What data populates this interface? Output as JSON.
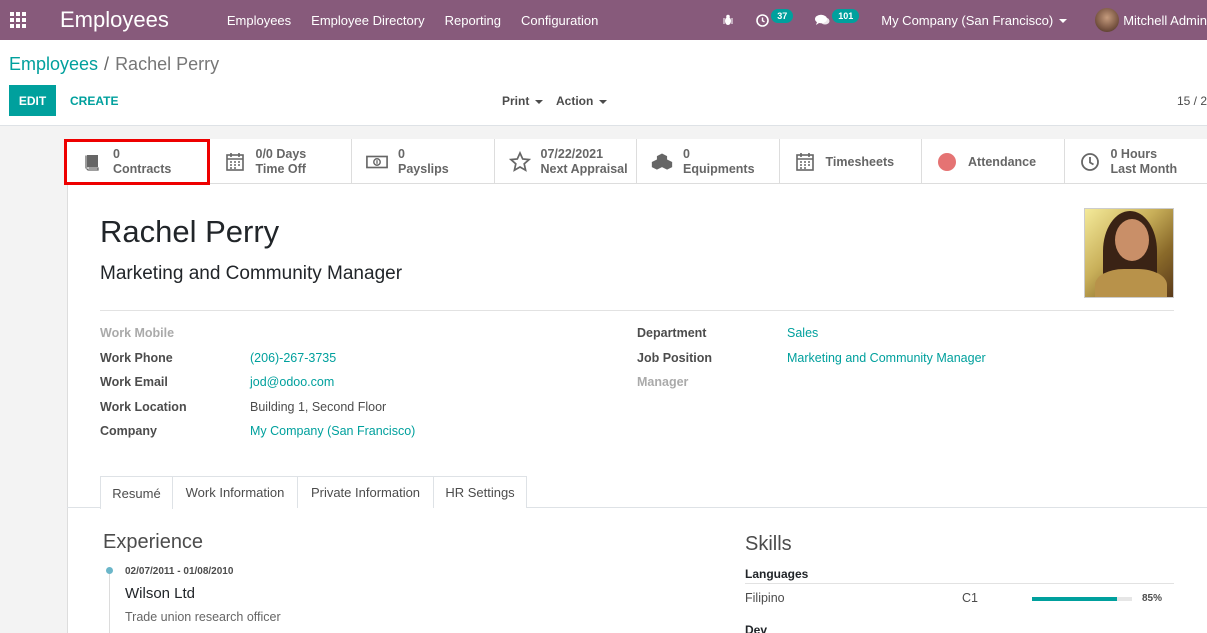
{
  "navbar": {
    "app_name": "Employees",
    "menu": [
      "Employees",
      "Employee Directory",
      "Reporting",
      "Configuration"
    ],
    "activity_count": "37",
    "message_count": "101",
    "company": "My Company (San Francisco)",
    "user": "Mitchell Admin",
    "bg_color": "#875a7b"
  },
  "control": {
    "breadcrumb_parent": "Employees",
    "breadcrumb_sep": "/",
    "breadcrumb_current": "Rachel Perry",
    "edit_label": "EDIT",
    "create_label": "CREATE",
    "print_label": "Print",
    "action_label": "Action",
    "pager": "15 / 2"
  },
  "smart_buttons": [
    {
      "value": "0",
      "label": "Contracts",
      "icon": "book-icon"
    },
    {
      "value": "0/0 Days",
      "label": "Time Off",
      "icon": "calendar-icon"
    },
    {
      "value": "0",
      "label": "Payslips",
      "icon": "money-icon"
    },
    {
      "value": "07/22/2021",
      "label": "Next Appraisal",
      "icon": "star-icon"
    },
    {
      "value": "0",
      "label": "Equipments",
      "icon": "cubes-icon"
    },
    {
      "value": "",
      "label": "Timesheets",
      "icon": "calendar-icon"
    },
    {
      "value": "",
      "label": "Attendance",
      "icon": "status-dot-icon"
    },
    {
      "value": "0 Hours",
      "label": "Last Month",
      "icon": "clock-icon"
    }
  ],
  "employee": {
    "name": "Rachel Perry",
    "job_title": "Marketing and Community Manager"
  },
  "fields_left": [
    {
      "label": "Work Mobile",
      "value": ""
    },
    {
      "label": "Work Phone",
      "value": "(206)-267-3735"
    },
    {
      "label": "Work Email",
      "value": "jod@odoo.com"
    },
    {
      "label": "Work Location",
      "value": "Building 1, Second Floor"
    },
    {
      "label": "Company",
      "value": "My Company (San Francisco)"
    }
  ],
  "fields_right": [
    {
      "label": "Department",
      "value": "Sales"
    },
    {
      "label": "Job Position",
      "value": "Marketing and Community Manager"
    },
    {
      "label": "Manager",
      "value": ""
    }
  ],
  "tabs": [
    "Resumé",
    "Work Information",
    "Private Information",
    "HR Settings"
  ],
  "resume": {
    "experience_title": "Experience",
    "entries": [
      {
        "dates": "02/07/2011 - 01/08/2010",
        "company": "Wilson Ltd",
        "title": "Trade union research officer"
      }
    ]
  },
  "skills": {
    "title": "Skills",
    "groups": [
      {
        "name": "Languages",
        "items": [
          {
            "name": "Filipino",
            "level": "C1",
            "progress": 85,
            "progress_label": "85%"
          }
        ]
      },
      {
        "name": "Dev",
        "items": []
      }
    ]
  },
  "colors": {
    "accent": "#00a09d",
    "attendance_dot": "#e57373",
    "highlight_box": "#ee0000"
  }
}
